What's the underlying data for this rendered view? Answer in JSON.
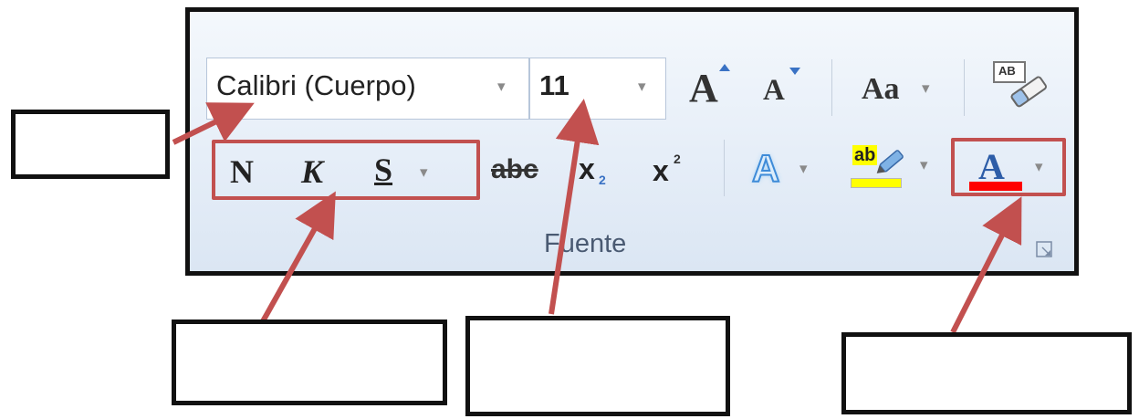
{
  "font_group": {
    "font_name_value": "Calibri (Cuerpo)",
    "font_size_value": "11",
    "grow_font_glyph": "A",
    "shrink_font_glyph": "A",
    "change_case_glyph": "Aa",
    "clear_format_glyph": "AB",
    "bold_glyph": "N",
    "italic_glyph": "K",
    "underline_glyph": "S",
    "strikethrough_glyph": "abc",
    "subscript_glyph": "x",
    "subscript_digit": "2",
    "superscript_glyph": "x",
    "superscript_digit": "2",
    "text_effects_glyph": "A",
    "highlight_glyph": "ab",
    "font_color_glyph": "A",
    "group_label": "Fuente",
    "dropdown_caret": "▾"
  },
  "colors": {
    "annotation_arrow": "#c2504f",
    "font_color_bar": "#ff0000",
    "highlight_bar": "#ffff00",
    "ribbon_border": "#111111"
  },
  "icons": [
    "dialog-launcher-icon",
    "eraser-icon",
    "highlighter-pen-icon",
    "text-effects-icon"
  ]
}
